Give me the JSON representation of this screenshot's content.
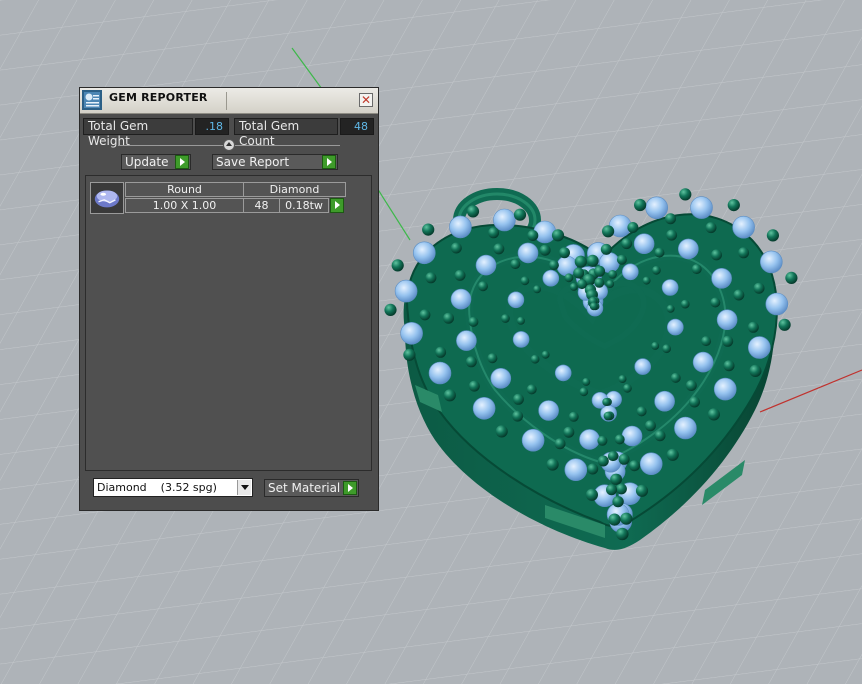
{
  "window": {
    "title": "GEM REPORTER",
    "close_glyph": "✕"
  },
  "totals": {
    "weight_label": "Total Gem Weight",
    "weight_value": ".18",
    "count_label": "Total Gem Count",
    "count_value": "48"
  },
  "actions": {
    "update_label": "Update",
    "save_report_label": "Save Report"
  },
  "gem_table": {
    "rows": [
      {
        "shape": "Round",
        "material": "Diamond",
        "size": "1.00 X 1.00",
        "count": "48",
        "weight": "0.18tw"
      }
    ]
  },
  "material": {
    "selected": "Diamond    (3.52 spg)",
    "set_material_label": "Set Material"
  },
  "colors": {
    "panel_bg": "#4d4d4d",
    "value_text": "#5fb7e6",
    "green_arrow": "#3e9b2a",
    "model_metal": "#0f6b52",
    "model_gem": "#8fc0ee",
    "axis_green": "#3db84a",
    "axis_red": "#c0322e"
  },
  "icons": [
    "gem-reporter-app-icon",
    "close-icon",
    "play-arrow-icon",
    "dropdown-arrow-icon",
    "gem-thumbnail-icon"
  ]
}
